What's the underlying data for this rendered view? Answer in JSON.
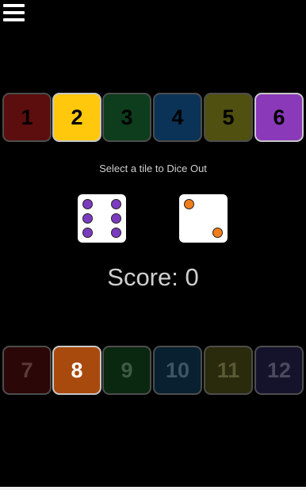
{
  "menu": {
    "icon": "hamburger-menu-icon"
  },
  "top_tiles": [
    {
      "label": "1",
      "bg": "#5c0d0d",
      "fg": "#000000",
      "selected": false
    },
    {
      "label": "2",
      "bg": "#ffc80c",
      "fg": "#000000",
      "selected": true
    },
    {
      "label": "3",
      "bg": "#0d3d1c",
      "fg": "#000000",
      "selected": false
    },
    {
      "label": "4",
      "bg": "#0b3357",
      "fg": "#000000",
      "selected": false
    },
    {
      "label": "5",
      "bg": "#505010",
      "fg": "#000000",
      "selected": false
    },
    {
      "label": "6",
      "bg": "#8a3ab8",
      "fg": "#000000",
      "selected": true
    }
  ],
  "instruction": "Select a tile to Dice Out",
  "dice": [
    {
      "value": 6,
      "pip_color": "#7b3bbf"
    },
    {
      "value": 2,
      "pip_color": "#f07d1a"
    }
  ],
  "score": {
    "text": "Score: 0"
  },
  "bottom_tiles": [
    {
      "label": "7",
      "bg": "#2c0707",
      "fg": "#5a3a3a",
      "selected": false
    },
    {
      "label": "8",
      "bg": "#a84a0d",
      "fg": "#ffffff",
      "selected": true
    },
    {
      "label": "9",
      "bg": "#0a2710",
      "fg": "#3e5a44",
      "selected": false
    },
    {
      "label": "10",
      "bg": "#08202f",
      "fg": "#3d5565",
      "selected": false
    },
    {
      "label": "11",
      "bg": "#2a2a0c",
      "fg": "#5a5a36",
      "selected": false
    },
    {
      "label": "12",
      "bg": "#15132c",
      "fg": "#4a4a5e",
      "selected": false
    }
  ]
}
